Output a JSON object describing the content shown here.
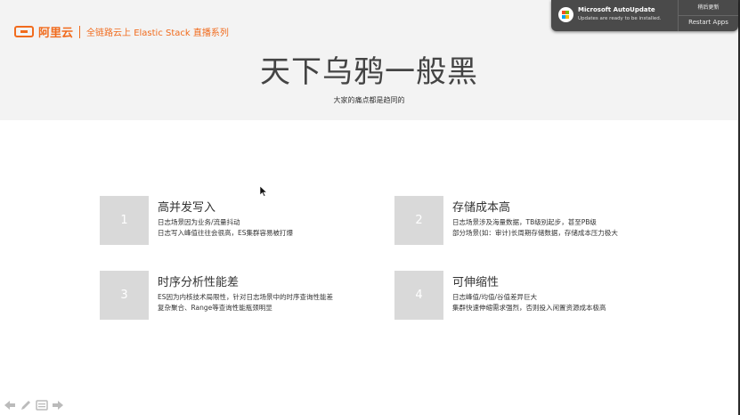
{
  "header": {
    "logo_text": "阿里云",
    "series_text": "全链路云上 Elastic Stack 直播系列",
    "title": "天下乌鸦一般黑",
    "subtitle": "大家的痛点都是趋同的"
  },
  "cards": [
    {
      "num": "1",
      "title": "高并发写入",
      "desc1": "日志场景因为业务/流量抖动",
      "desc2": "日志写入峰值往往会很高，ES集群容易被打爆"
    },
    {
      "num": "2",
      "title": "存储成本高",
      "desc1": "日志场景涉及海量数据，TB级别起步，甚至PB级",
      "desc2": "部分场景(如：审计)长周期存储数据，存储成本压力极大"
    },
    {
      "num": "3",
      "title": "时序分析性能差",
      "desc1": "ES因为内核技术局限性，针对日志场景中的时序查询性能差",
      "desc2": "复杂聚合、Range等查询性能瓶颈明显"
    },
    {
      "num": "4",
      "title": "可伸缩性",
      "desc1": "日志峰值/均值/谷值差异巨大",
      "desc2": "集群快速伸缩需求强烈，否则投入闲置资源成本极高"
    }
  ],
  "notification": {
    "title": "Microsoft AutoUpdate",
    "body": "Updates are ready to be installed.",
    "button_later": "稍后更新",
    "button_restart": "Restart Apps"
  },
  "colors": {
    "brand": "#f16b1d",
    "number_box": "#d9d9d9",
    "header_bg": "#f3f3f3"
  }
}
